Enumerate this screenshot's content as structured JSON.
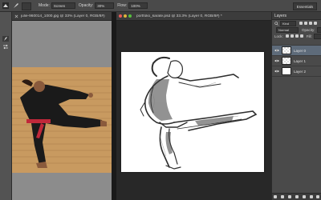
{
  "options_bar": {
    "mode_label": "Mode:",
    "mode_value": "Screen",
    "opacity_label": "Opacity:",
    "opacity_value": "30%",
    "flow_label": "Flow:",
    "flow_value": "100%",
    "workspace": "Essentials"
  },
  "doc1": {
    "title": "julie-960014_1000.jpg @ 33% (Layer 0, RGB/8#)"
  },
  "doc2": {
    "title": "portfolio_karate.psd @ 33.3% (Layer 0, RGB/8#) *"
  },
  "layers_panel": {
    "title": "Layers",
    "filter_label": "Kind",
    "blend_mode": "Normal",
    "opacity_label": "Opacity:",
    "lock_label": "Lock:",
    "fill_label": "Fill:",
    "layers": [
      {
        "name": "Layer 0",
        "selected": true
      },
      {
        "name": "Layer 1",
        "selected": false
      },
      {
        "name": "Layer 2",
        "selected": false
      }
    ]
  },
  "colors": {
    "accent": "#31a9e0",
    "traffic_red": "#ec5b57",
    "traffic_yellow": "#e0b43a",
    "traffic_green": "#56c13e",
    "belt": "#c0283a"
  }
}
